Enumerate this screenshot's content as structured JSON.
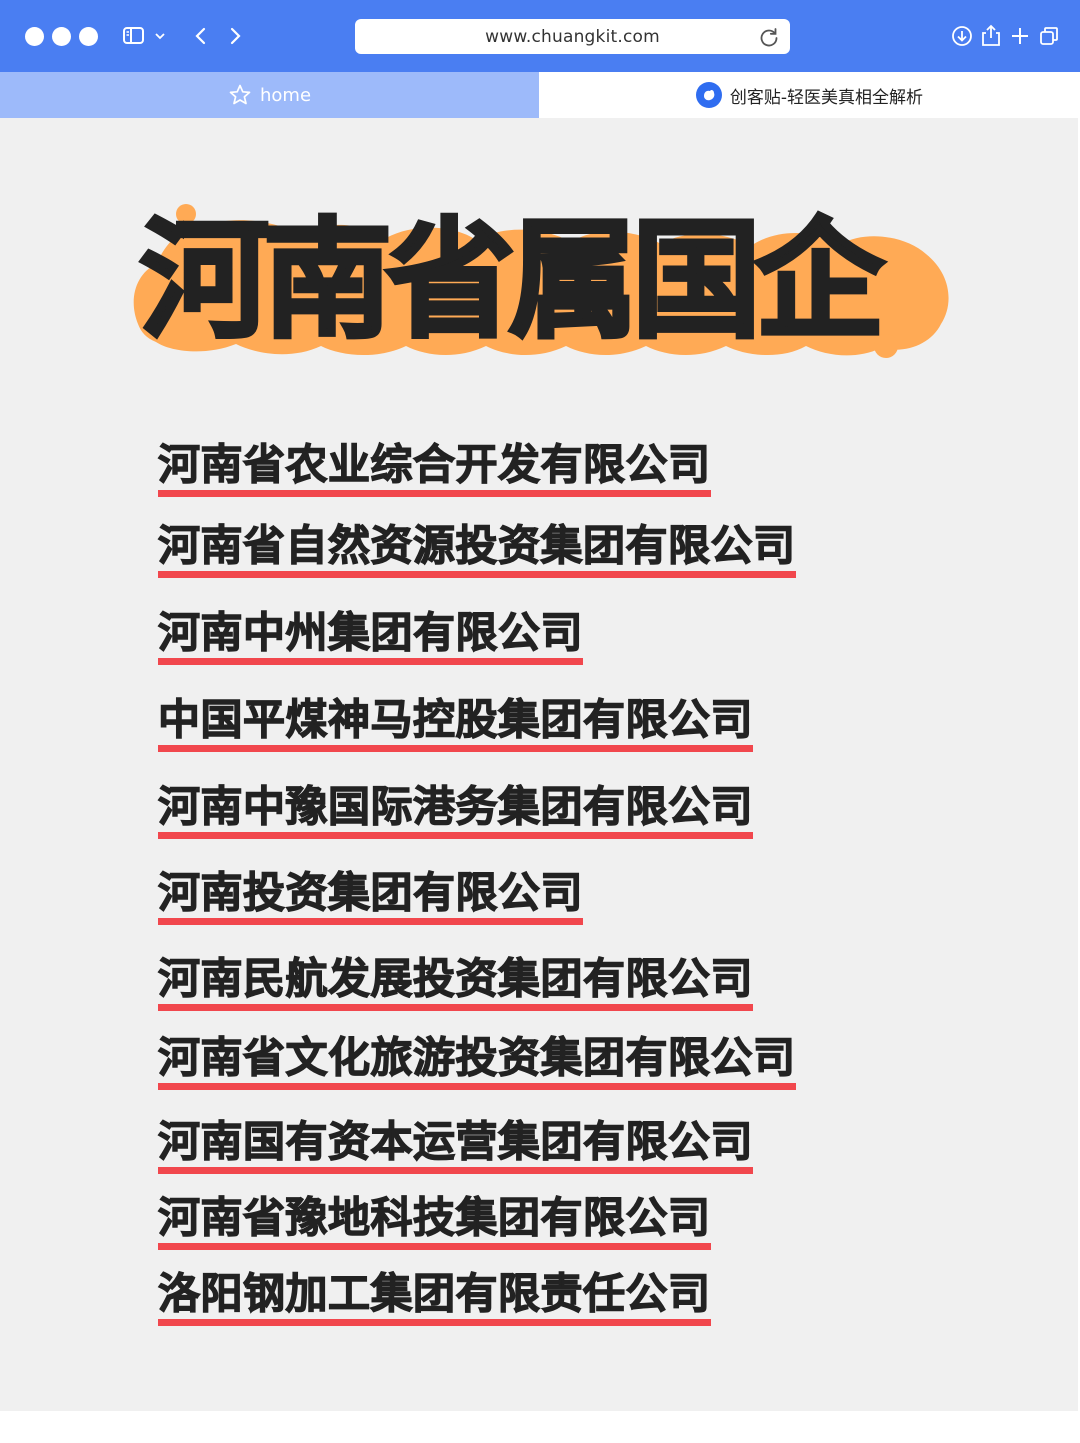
{
  "toolbar": {
    "url": "www.chuangkit.com",
    "icons": [
      "window-dots",
      "sidebar-icon",
      "chevron-down-icon",
      "back-icon",
      "forward-icon",
      "reload-icon",
      "download-icon",
      "share-icon",
      "new-tab-icon",
      "tabs-overview-icon"
    ]
  },
  "tabs": {
    "home_label": "home",
    "active_label": "创客贴-轻医美真相全解析"
  },
  "hero": {
    "title": "河南省属国企"
  },
  "companies": [
    "河南省农业综合开发有限公司",
    "河南省自然资源投资集团有限公司",
    "河南中州集团有限公司",
    "中国平煤神马控股集团有限公司",
    "河南中豫国际港务集团有限公司",
    "河南投资集团有限公司",
    "河南民航发展投资集团有限公司",
    "河南省文化旅游投资集团有限公司",
    "河南国有资本运营集团有限公司",
    "河南省豫地科技集团有限公司",
    "洛阳钢加工集团有限责任公司"
  ],
  "colors": {
    "toolbar": "#4a7ef2",
    "home_tab": "#9dbafa",
    "content_bg": "#f0f0f0",
    "hero_blob": "#ffaa55",
    "underline": "#f1474d",
    "text": "#222222"
  }
}
